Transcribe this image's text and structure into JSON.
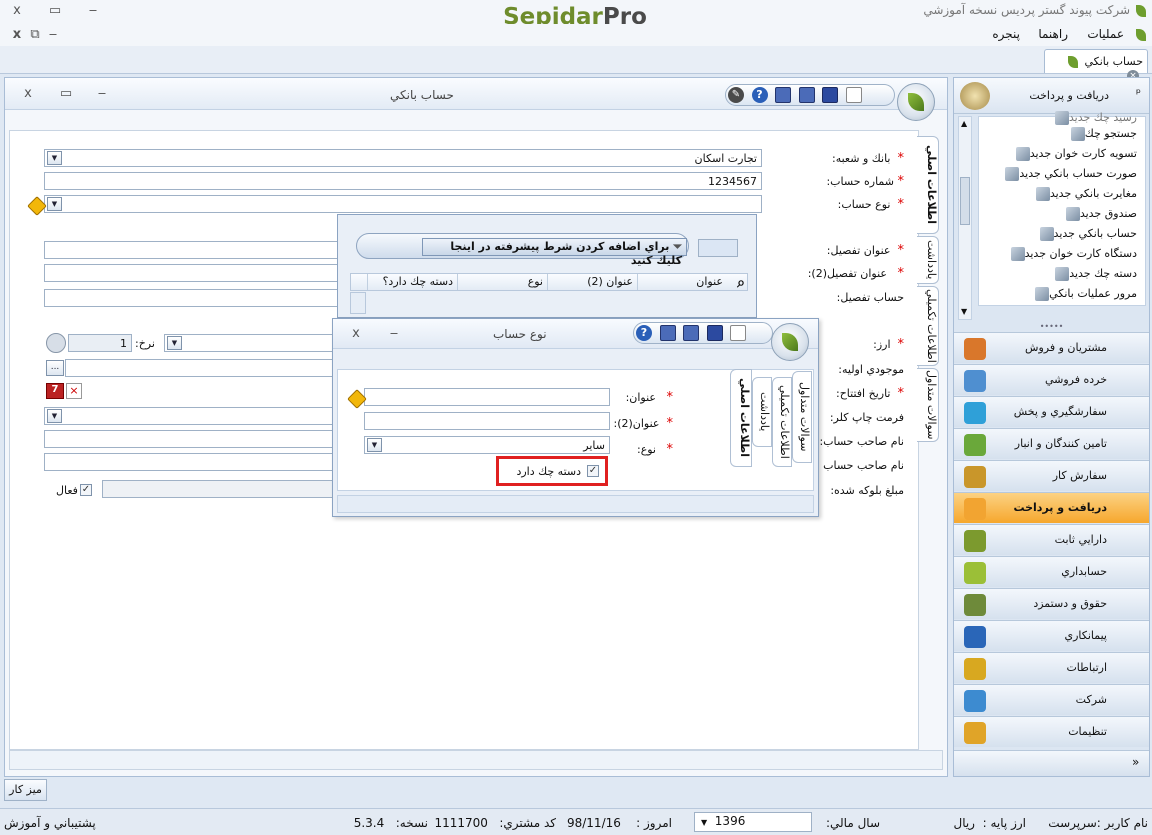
{
  "app": {
    "brand_main": "Sepidar",
    "brand_suffix": "Pro",
    "company_title": "شرکت پیوند گستر پردیس نسخه آموزشي",
    "win_close": "x",
    "win_restore": "▭",
    "win_min": "‒"
  },
  "menu": {
    "items": [
      "عمليات",
      "راهنما",
      "پنجره"
    ],
    "close": "x",
    "restore": "⧉",
    "min": "‒"
  },
  "doc_tab": {
    "label": "حساب بانکي"
  },
  "main_window": {
    "title": "حساب بانکي",
    "close": "x",
    "restore": "▭",
    "min": "‒"
  },
  "form": {
    "bank_branch_label": "بانك و شعبه:",
    "bank_branch_value": "تجارت اسكان",
    "account_no_label": "شماره حساب:",
    "account_no_value": "1234567",
    "account_type_label": "نوع حساب:",
    "detail_title_label": "عنوان تفصیل:",
    "detail_title2_label": "عنوان تفصیل(2):",
    "detail_account_label": "حساب تفصیل:",
    "currency_label": "ارز:",
    "rate_label": "نرخ:",
    "rate_value": "1",
    "initial_balance_label": "موجودي اوليه:",
    "open_date_label": "تاريخ  افتتاح:",
    "print_format_label": "فرمت چاپ کلر:",
    "owner_name_label": "نام صاحب حساب:",
    "owner_name2_label": "نام صاحب حساب",
    "blocked_amount_label": "مبلغ بلوکه شده:",
    "active_label": "فعال",
    "ellipsis": "...",
    "required_mark": "*"
  },
  "vtabs": [
    "اطلاعات اصلي",
    "يادداشت",
    "اطلاعات تكميلي",
    "سوالات متداول"
  ],
  "grid_popup": {
    "filter_hint": "براي اضافه كردن شرط پيشرفته در اينجا كليك كنيد",
    "columns": [
      "عنوان",
      "عنوان (2)",
      "نوع",
      "دسته چك دارد؟"
    ]
  },
  "dialog": {
    "title": "نوع حساب",
    "close": "x",
    "min": "‒",
    "title_label": "عنوان:",
    "title2_label": "عنوان(2):",
    "type_label": "نوع:",
    "type_value": "سایر",
    "has_checkbook_label": "دسته چك دارد",
    "tabs": [
      "اطلاعات اصلي",
      "يادداشت",
      "اطلاعات تكميلي",
      "سوالات متداول"
    ]
  },
  "sidebar": {
    "header": "دريافت و پرداخت",
    "pin": "ᵖ",
    "sub_items": [
      "جستجو چك",
      "تسويه كارت خوان جديد",
      "صورت حساب بانکي جديد",
      "مغايرت بانکي جديد",
      "صندوق جديد",
      "حساب بانکي جديد",
      "دستگاه كارت خوان جديد",
      "دسته چك جديد",
      "مرور عمليات بانکي"
    ],
    "partial_item": "رسيد چك جديد",
    "nav": [
      "مشتريان و فروش",
      "خرده فروشي",
      "سفارشگيري و پخش",
      "تامين كنندگان و انبار",
      "سفارش كار",
      "دريافت و پرداخت",
      "دارايي ثابت",
      "حسابداري",
      "حقوق و دستمزد",
      "پيمانكاري",
      "ارتباطات",
      "شركت",
      "تنظيمات"
    ],
    "active_index": 5,
    "nav_colors": [
      "#d9772b",
      "#4f8fd0",
      "#2fa0d8",
      "#6aa83a",
      "#c9962a",
      "#f2a431",
      "#7c9a2e",
      "#9bbf37",
      "#6e8a3a",
      "#2a66b8",
      "#d8a820",
      "#3d8bd0",
      "#e0a428"
    ],
    "more": "»"
  },
  "bottom": {
    "desk_button": "ميز كار"
  },
  "status": {
    "user_label": "نام كاربر :",
    "user_value": "سرپرست",
    "base_currency_label": "ارز پايه :",
    "base_currency_value": "ريال",
    "fiscal_year_label": "سال مالي:",
    "fiscal_year_value": "1396",
    "today_label": "امروز :",
    "today_value": "98/11/16",
    "customer_code_label": "كد مشتري:",
    "customer_code_value": "1111700",
    "version_label": "نسخه:",
    "version_value": "5.3.4",
    "support_link": "پشتيباني و آموزش"
  }
}
